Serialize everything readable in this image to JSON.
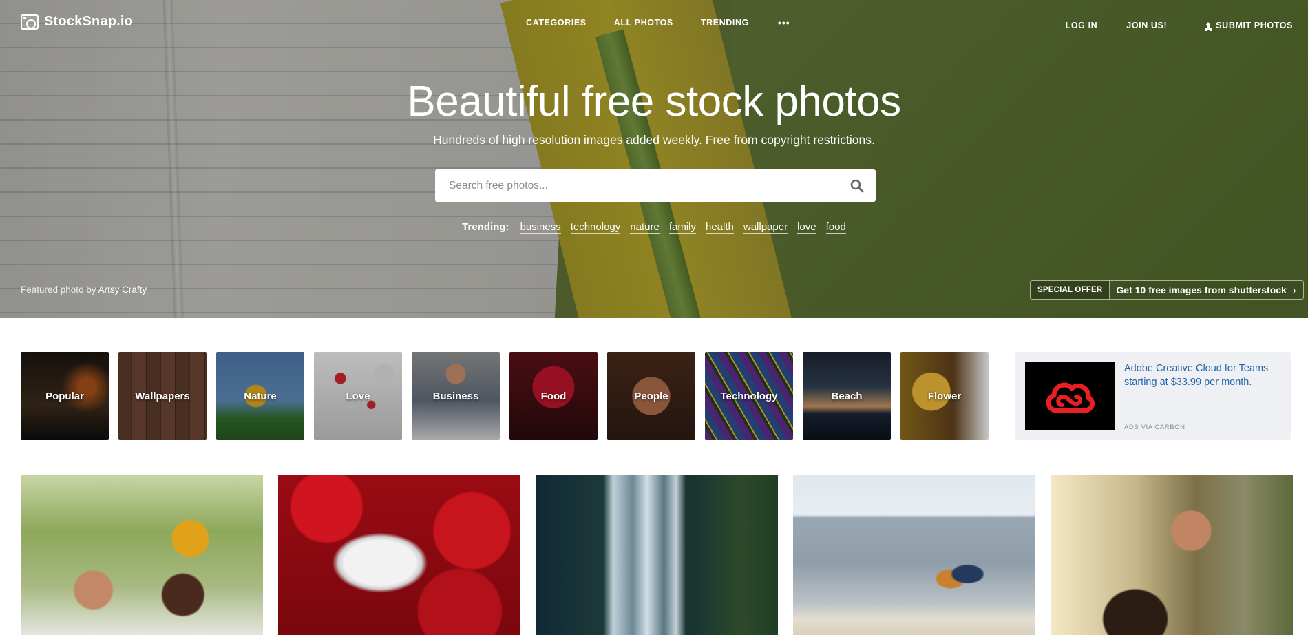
{
  "brand": {
    "name": "StockSnap.io"
  },
  "nav": {
    "center": [
      "CATEGORIES",
      "ALL PHOTOS",
      "TRENDING"
    ],
    "more": "•••",
    "login": "LOG IN",
    "join": "JOIN US!",
    "submit": "SUBMIT PHOTOS"
  },
  "hero": {
    "title": "Beautiful free stock photos",
    "subtitle": "Hundreds of high resolution images added weekly.",
    "subtitle_link": "Free from copyright restrictions.",
    "search_placeholder": "Search free photos...",
    "trending_label": "Trending:",
    "trending_tags": [
      "business",
      "technology",
      "nature",
      "family",
      "health",
      "wallpaper",
      "love",
      "food"
    ],
    "featured_prefix": "Featured photo by",
    "featured_author": "Artsy Crafty",
    "offer_badge": "SPECIAL OFFER",
    "offer_text": "Get 10 free images from shutterstock"
  },
  "categories": [
    "Popular",
    "Wallpapers",
    "Nature",
    "Love",
    "Business",
    "Food",
    "People",
    "Technology",
    "Beach",
    "Flower"
  ],
  "ad": {
    "text": "Adobe Creative Cloud for Teams starting at $33.99 per month.",
    "via": "ADS VIA CARBON",
    "logo_color": "#ea1f23"
  },
  "photos": [
    "family",
    "hearts",
    "waterfall",
    "couple-beach",
    "photographer"
  ],
  "colors": {
    "accent_link": "#2466a9",
    "hero_green": "#6b7f3c"
  }
}
